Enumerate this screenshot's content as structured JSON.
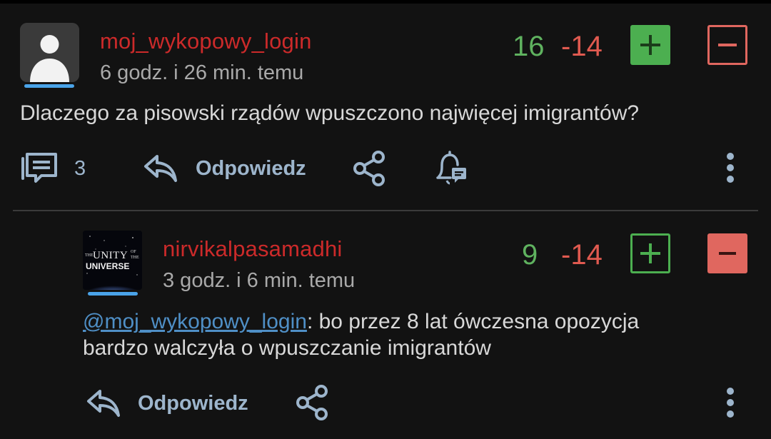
{
  "post": {
    "username": "moj_wykopowy_login",
    "timestamp": "6 godz. i 26 min. temu",
    "plus_count": "16",
    "minus_count": "-14",
    "body": "Dlaczego za pisowski rządów wpuszczono najwięcej imigrantów?",
    "comment_count": "3",
    "reply_label": "Odpowiedz",
    "avatar_icon": "default-user-avatar-icon"
  },
  "reply": {
    "username": "nirvikalpasamadhi",
    "timestamp": "3 godz. i 6 min. temu",
    "plus_count": "9",
    "minus_count": "-14",
    "mention": "@moj_wykopowy_login",
    "body_line1": ": bo przez 8 lat ówczesna opozycja",
    "body_line2": "bardzo walczyła o wpuszczanie imigrantów",
    "reply_label": "Odpowiedz",
    "avatar_text": {
      "the": "THE",
      "unity": "UNITY",
      "of": "OF",
      "the2": "THE",
      "universe": "UNIVERSE"
    }
  },
  "colors": {
    "background": "#121212",
    "username": "#cc2a2a",
    "upvote": "#4caf50",
    "downvote": "#e0675f",
    "action": "#9db5cc",
    "mention": "#4f8fc6"
  }
}
